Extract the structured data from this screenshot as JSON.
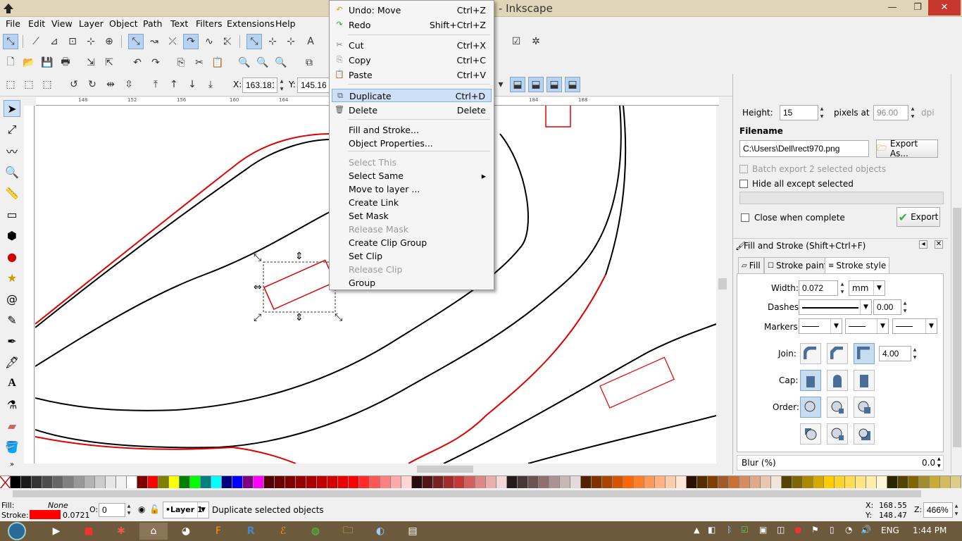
{
  "window": {
    "title": "- Inkscape",
    "minimize": "—",
    "maximize": "❐",
    "close": "✕"
  },
  "menubar": {
    "items": [
      "File",
      "Edit",
      "View",
      "Layer",
      "Object",
      "Path",
      "Text",
      "Filters",
      "Extensions",
      "Help"
    ]
  },
  "toolctrl": {
    "x_label": "X:",
    "x_value": "163.181",
    "y_label": "Y:",
    "y_value": "145.160"
  },
  "context_menu": {
    "items": [
      {
        "label": "Undo: Move",
        "shortcut": "Ctrl+Z",
        "icon": "undo-icon",
        "disabled": false
      },
      {
        "label": "Redo",
        "shortcut": "Shift+Ctrl+Z",
        "icon": "redo-icon",
        "disabled": false
      },
      {
        "label": "Cut",
        "shortcut": "Ctrl+X",
        "icon": "scissors-icon",
        "disabled": false
      },
      {
        "label": "Copy",
        "shortcut": "Ctrl+C",
        "icon": "copy-icon",
        "disabled": false
      },
      {
        "label": "Paste",
        "shortcut": "Ctrl+V",
        "icon": "paste-icon",
        "disabled": false
      },
      {
        "label": "Duplicate",
        "shortcut": "Ctrl+D",
        "icon": "duplicate-icon",
        "disabled": false,
        "highlighted": true
      },
      {
        "label": "Delete",
        "shortcut": "Delete",
        "icon": "trash-icon",
        "disabled": false
      },
      {
        "label": "Fill and Stroke...",
        "shortcut": "",
        "disabled": false
      },
      {
        "label": "Object Properties...",
        "shortcut": "",
        "disabled": false
      },
      {
        "label": "Select This",
        "shortcut": "",
        "disabled": true
      },
      {
        "label": "Select Same",
        "shortcut": "",
        "disabled": false,
        "submenu": true
      },
      {
        "label": "Move to layer ...",
        "shortcut": "",
        "disabled": false
      },
      {
        "label": "Create Link",
        "shortcut": "",
        "disabled": false
      },
      {
        "label": "Set Mask",
        "shortcut": "",
        "disabled": false
      },
      {
        "label": "Release Mask",
        "shortcut": "",
        "disabled": true
      },
      {
        "label": "Create Clip Group",
        "shortcut": "",
        "disabled": false
      },
      {
        "label": "Set Clip",
        "shortcut": "",
        "disabled": false
      },
      {
        "label": "Release Clip",
        "shortcut": "",
        "disabled": true
      },
      {
        "label": "Group",
        "shortcut": "",
        "disabled": false
      }
    ]
  },
  "export_panel": {
    "height_label": "Height:",
    "height_value": "15",
    "pixels_at_label": "pixels at",
    "dpi_value": "96.00",
    "dpi_label": "dpi",
    "filename_label": "Filename",
    "filename_value": "C:\\Users\\Dell\\rect970.png",
    "export_as_button": "Export As...",
    "batch_export_label": "Batch export 2 selected objects",
    "hide_all_label": "Hide all except selected",
    "close_when_complete_label": "Close when complete",
    "export_button": "Export"
  },
  "fill_stroke_panel": {
    "title": "Fill and Stroke (Shift+Ctrl+F)",
    "tabs": [
      "Fill",
      "Stroke paint",
      "Stroke style"
    ],
    "width_label": "Width:",
    "width_value": "0.072",
    "width_unit": "mm",
    "dashes_label": "Dashes:",
    "dash_offset": "0.00",
    "markers_label": "Markers:",
    "join_label": "Join:",
    "miter_limit": "4.00",
    "cap_label": "Cap:",
    "order_label": "Order:",
    "blur_label": "Blur (%)",
    "blur_value": "0.0"
  },
  "rulers": {
    "h_ticks": [
      "148",
      "152",
      "156",
      "160",
      "164",
      "184",
      "188"
    ]
  },
  "statusbar": {
    "fill_label": "Fill:",
    "fill_value": "None",
    "stroke_label": "Stroke:",
    "stroke_width": "0.0721",
    "opacity_label": "O:",
    "opacity_value": "0",
    "layer_value": "•Layer 1",
    "message": "Duplicate selected objects",
    "cursor_x_label": "X:",
    "cursor_x": "168.55",
    "cursor_y_label": "Y:",
    "cursor_y": "148.47",
    "zoom_label": "Z:",
    "zoom_value": "466%"
  },
  "taskbar": {
    "language": "ENG",
    "time": "1:44 PM"
  },
  "colors": {
    "stroke_swatch": "#ff0000",
    "selection_red": "#e00000",
    "title_bar": "#e0d5b8",
    "taskbar": "#6d5a3c",
    "highlight": "#cde0f7"
  },
  "palette": [
    "#000000",
    "#1a1a1a",
    "#333333",
    "#4d4d4d",
    "#666666",
    "#808080",
    "#999999",
    "#b3b3b3",
    "#cccccc",
    "#e6e6e6",
    "#f2f2f2",
    "#ffffff",
    "#800000",
    "#ff0000",
    "#808000",
    "#ffff00",
    "#008000",
    "#00ff00",
    "#008080",
    "#00ffff",
    "#000080",
    "#0000ff",
    "#800080",
    "#ff00ff",
    "#550000",
    "#6b0000",
    "#800000",
    "#950000",
    "#aa0000",
    "#c00000",
    "#d40000",
    "#ea0000",
    "#ff0000",
    "#ff2a2a",
    "#ff5555",
    "#ff8080",
    "#ffaaaa",
    "#ffd5d5",
    "#280b0b",
    "#501616",
    "#782121",
    "#a02c2c",
    "#c83737",
    "#d35f5f",
    "#de8787",
    "#e9afaf",
    "#f4d7d7",
    "#241c1c",
    "#483737",
    "#6c5353",
    "#916f6f",
    "#ac9393",
    "#c8b7b7",
    "#e3dbdb",
    "#552200",
    "#803300",
    "#aa4400",
    "#d45500",
    "#ff6600",
    "#ff7f2a",
    "#ff9955",
    "#ffb380",
    "#ffccaa",
    "#ffe6d5",
    "#2b1100",
    "#552b00",
    "#803f00",
    "#a05a2c",
    "#c87137",
    "#d38d5f",
    "#deaa87",
    "#e9c6af",
    "#f4e3d7",
    "#554400",
    "#806600",
    "#aa8800",
    "#d4aa00",
    "#ffcc00",
    "#ffd42a",
    "#ffdd55",
    "#ffe680",
    "#ffeeaa",
    "#fff6d5",
    "#2b2200",
    "#554400",
    "#806600",
    "#a08c2c",
    "#c8ab37",
    "#d3bc5f",
    "#decd87"
  ]
}
